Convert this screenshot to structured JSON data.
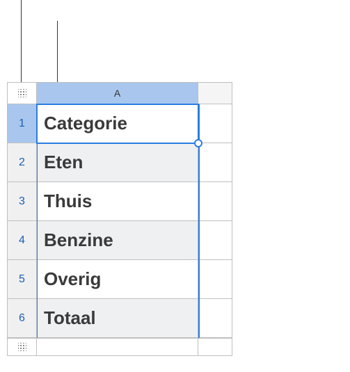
{
  "column_header": "A",
  "rows": [
    {
      "num": "1",
      "value": "Categorie"
    },
    {
      "num": "2",
      "value": "Eten"
    },
    {
      "num": "3",
      "value": "Thuis"
    },
    {
      "num": "4",
      "value": "Benzine"
    },
    {
      "num": "5",
      "value": "Overig"
    },
    {
      "num": "6",
      "value": "Totaal"
    }
  ]
}
